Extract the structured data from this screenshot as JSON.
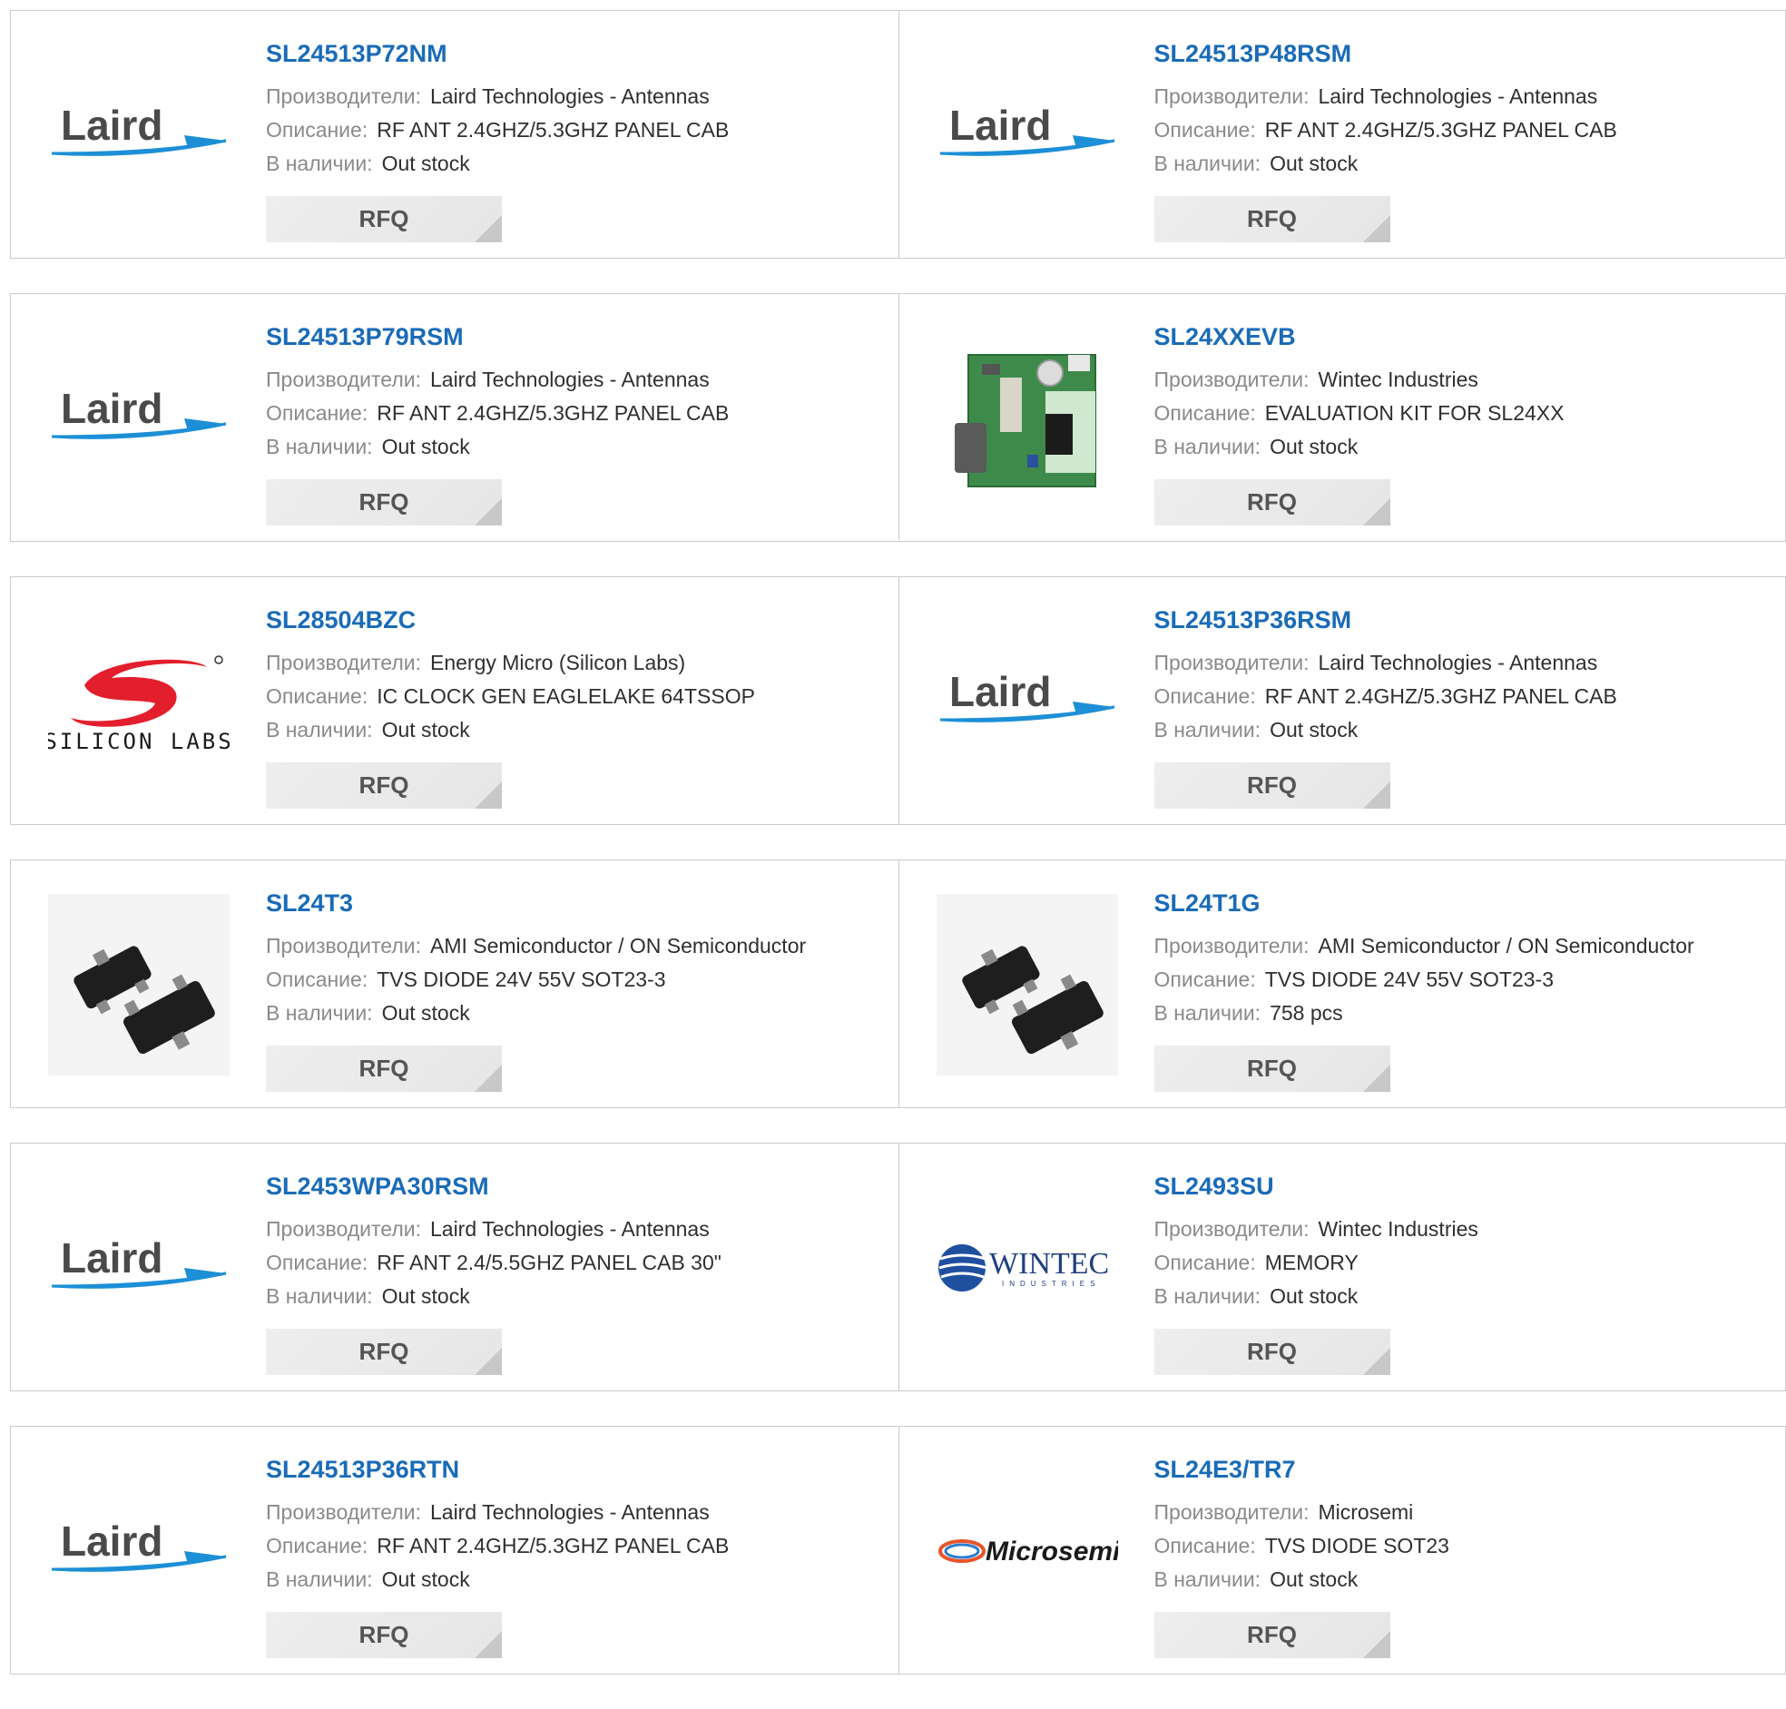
{
  "labels": {
    "manufacturer": "Производители:",
    "description": "Описание:",
    "stock": "В наличии:",
    "rfq": "RFQ"
  },
  "brands": {
    "laird": "Laird",
    "silicon": "SILICON LABS",
    "wintec": "WINTEC",
    "wintec_sub": "INDUSTRIES",
    "microsemi": "Microsemi"
  },
  "products": [
    {
      "part": "SL24513P72NM",
      "manufacturer": "Laird Technologies - Antennas",
      "description": "RF ANT 2.4GHZ/5.3GHZ PANEL CAB",
      "stock": "Out stock",
      "logo": "laird"
    },
    {
      "part": "SL24513P48RSM",
      "manufacturer": "Laird Technologies - Antennas",
      "description": "RF ANT 2.4GHZ/5.3GHZ PANEL CAB",
      "stock": "Out stock",
      "logo": "laird"
    },
    {
      "part": "SL24513P79RSM",
      "manufacturer": "Laird Technologies - Antennas",
      "description": "RF ANT 2.4GHZ/5.3GHZ PANEL CAB",
      "stock": "Out stock",
      "logo": "laird"
    },
    {
      "part": "SL24XXEVB",
      "manufacturer": "Wintec Industries",
      "description": "EVALUATION KIT FOR SL24XX",
      "stock": "Out stock",
      "logo": "pcb-board"
    },
    {
      "part": "SL28504BZC",
      "manufacturer": "Energy Micro (Silicon Labs)",
      "description": "IC CLOCK GEN EAGLELAKE 64TSSOP",
      "stock": "Out stock",
      "logo": "silicon-labs"
    },
    {
      "part": "SL24513P36RSM",
      "manufacturer": "Laird Technologies - Antennas",
      "description": "RF ANT 2.4GHZ/5.3GHZ PANEL CAB",
      "stock": "Out stock",
      "logo": "laird"
    },
    {
      "part": "SL24T3",
      "manufacturer": "AMI Semiconductor / ON Semiconductor",
      "description": "TVS DIODE 24V 55V SOT23-3",
      "stock": "Out stock",
      "logo": "sot23-chip"
    },
    {
      "part": "SL24T1G",
      "manufacturer": "AMI Semiconductor / ON Semiconductor",
      "description": "TVS DIODE 24V 55V SOT23-3",
      "stock": "758 pcs",
      "logo": "sot23-chip"
    },
    {
      "part": "SL2453WPA30RSM",
      "manufacturer": "Laird Technologies - Antennas",
      "description": "RF ANT 2.4/5.5GHZ PANEL CAB 30\"",
      "stock": "Out stock",
      "logo": "laird"
    },
    {
      "part": "SL2493SU",
      "manufacturer": "Wintec Industries",
      "description": "MEMORY",
      "stock": "Out stock",
      "logo": "wintec"
    },
    {
      "part": "SL24513P36RTN",
      "manufacturer": "Laird Technologies - Antennas",
      "description": "RF ANT 2.4GHZ/5.3GHZ PANEL CAB",
      "stock": "Out stock",
      "logo": "laird"
    },
    {
      "part": "SL24E3/TR7",
      "manufacturer": "Microsemi",
      "description": "TVS DIODE SOT23",
      "stock": "Out stock",
      "logo": "microsemi"
    }
  ],
  "colors": {
    "part_link": "#1a6bb8",
    "label": "#8a8a8a",
    "value": "#2f2f2f",
    "border": "#cccccc",
    "button_bg": "#eeeeee",
    "laird_swoosh": "#1c8fd6",
    "silicon_red": "#e41f2d"
  }
}
